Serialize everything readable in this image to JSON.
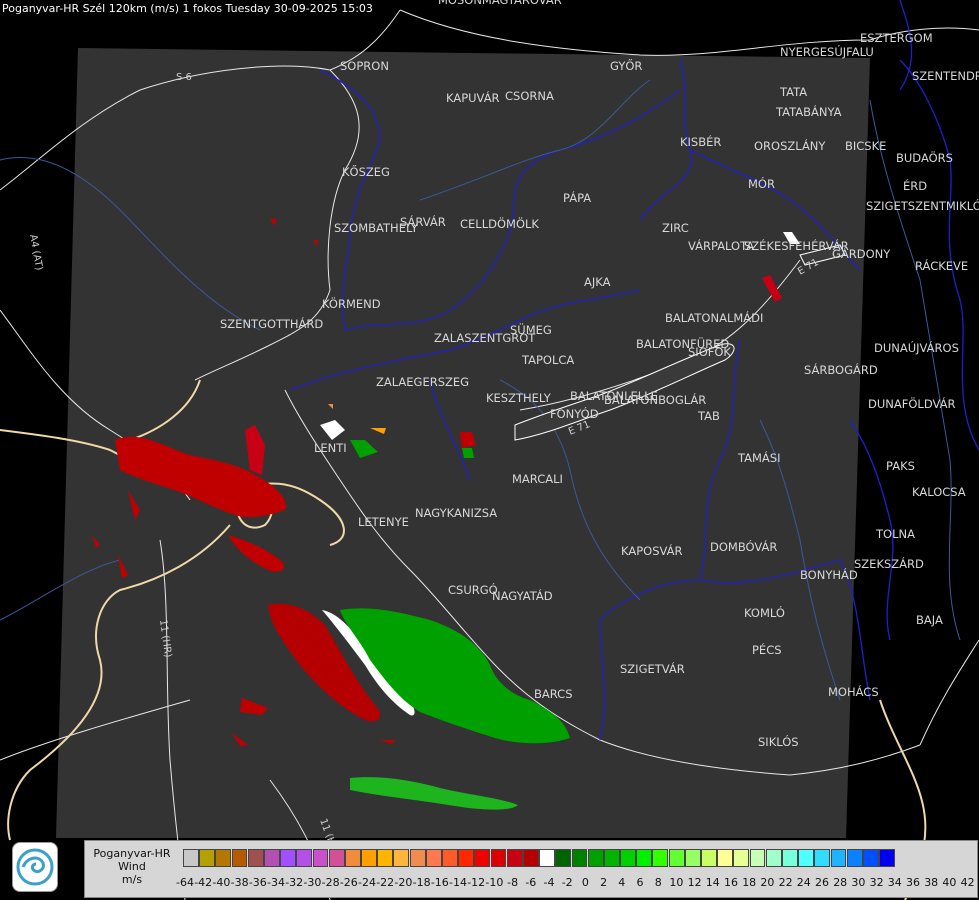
{
  "header": {
    "title": "Poganyvar-HR Szél 120km (m/s) 1 fokos Tuesday 30-09-2025 15:03"
  },
  "legend": {
    "line1": "Poganyvar-HR",
    "line2": "Wind",
    "line3": "m/s",
    "colors": [
      "#c8c8c8",
      "#b4a000",
      "#b47800",
      "#b45a00",
      "#a05050",
      "#b450b4",
      "#a050ff",
      "#b450e6",
      "#c850c8",
      "#d25096",
      "#f08c3c",
      "#ffa000",
      "#ffb400",
      "#ffb43c",
      "#f08c50",
      "#ff7850",
      "#ff5a28",
      "#ff2800",
      "#f00000",
      "#dc0000",
      "#c80014",
      "#b40000",
      "#ffffff",
      "#006400",
      "#008200",
      "#00a000",
      "#00b400",
      "#00d200",
      "#00f000",
      "#32ff00",
      "#64ff32",
      "#96ff64",
      "#c8ff64",
      "#ffff96",
      "#e6ff96",
      "#c8ffb4",
      "#a0ffc8",
      "#78ffdc",
      "#50ffff",
      "#32dcff",
      "#1eb4ff",
      "#0a82ff",
      "#0050ff",
      "#0000f0"
    ],
    "ticks": [
      "-64",
      "-42",
      "-40",
      "-38",
      "-36",
      "-34",
      "-32",
      "-30",
      "-28",
      "-26",
      "-24",
      "-22",
      "-20",
      "-18",
      "-16",
      "-14",
      "-12",
      "-10",
      "-8",
      "-6",
      "-4",
      "-2",
      "0",
      "2",
      "4",
      "6",
      "8",
      "10",
      "12",
      "14",
      "16",
      "18",
      "20",
      "22",
      "24",
      "26",
      "28",
      "30",
      "32",
      "34",
      "36",
      "38",
      "40",
      "42"
    ]
  },
  "road_labels": [
    "S 6",
    "A4 (AT)",
    "E 71",
    "E 71",
    "11 (HR)",
    "11 (HR)"
  ],
  "cities": [
    "MOSONMAGYARÓVÁR",
    "ESZTERGOM",
    "NYERGESÚJFALU",
    "SZENTENDRE",
    "SOPRON",
    "GYŐR",
    "KAPUVÁR",
    "CSORNA",
    "TATA",
    "TATABÁNYA",
    "KISBÉR",
    "OROSZLÁNY",
    "BICSKE",
    "BUDAÖRS",
    "ÉRD",
    "SZIGETSZENTMIKLÓS",
    "KŐSZEG",
    "MÓR",
    "PÁPA",
    "SZOMBATHELY",
    "SÁRVÁR",
    "CELLDÖMÖLK",
    "ZIRC",
    "VÁRPALOTA",
    "SZÉKESFEHÉRVÁR",
    "GÁRDONY",
    "RÁCKEVE",
    "AJKA",
    "KÖRMEND",
    "SZENTGOTTHÁRD",
    "BALATONALMÁDI",
    "SÜMEG",
    "ZALASZENTGRÓT",
    "BALATONFÜRED",
    "TAPOLCA",
    "SIÓFOK",
    "DUNAÚJVÁROS",
    "ZALAEGERSZEG",
    "SÁRBOGÁRD",
    "KESZTHELY",
    "BALATONLELLE",
    "FONYÓD",
    "BALATONBOGLÁR",
    "TAB",
    "DUNAFÖLDVÁR",
    "LENTI",
    "TAMÁSI",
    "PAKS",
    "MARCALI",
    "KALOCSA",
    "LETENYE",
    "NAGYKANIZSA",
    "KAPOSVÁR",
    "DOMBÓVÁR",
    "TOLNA",
    "SZEKSZÁRD",
    "BONYHÁD",
    "CSURGÓ",
    "NAGYATÁD",
    "KOMLÓ",
    "BAJA",
    "PÉCS",
    "SZIGETVÁR",
    "MOHÁCS",
    "BARCS",
    "SIKLÓS"
  ]
}
